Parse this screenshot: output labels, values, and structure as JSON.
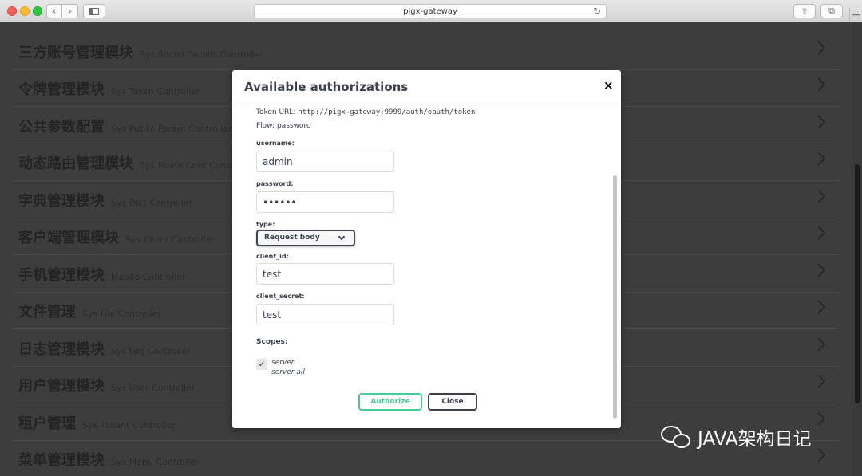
{
  "browser": {
    "url": "pigx-gateway",
    "back_icon": "chevron-left-icon",
    "forward_icon": "chevron-right-icon",
    "sidebar_icon": "sidebar-icon",
    "reload_icon": "reload-icon",
    "share_icon": "share-icon",
    "tabs_icon": "tabs-icon",
    "reload_glyph": "↻",
    "back_glyph": "‹",
    "forward_glyph": "›",
    "share_glyph": "⇧",
    "tabs_glyph": "⧉",
    "newtab_glyph": "+"
  },
  "controllers": [
    {
      "title": "三方账号管理模块",
      "subtitle": "Sys Social Details Controller"
    },
    {
      "title": "令牌管理模块",
      "subtitle": "Sys Token Controller"
    },
    {
      "title": "公共参数配置",
      "subtitle": "Sys Public Param Controller"
    },
    {
      "title": "动态路由管理模块",
      "subtitle": "Sys Route Conf Controller"
    },
    {
      "title": "字典管理模块",
      "subtitle": "Sys Dict Controller"
    },
    {
      "title": "客户端管理模块",
      "subtitle": "Sys Client Controller"
    },
    {
      "title": "手机管理模块",
      "subtitle": "Mobile Controller"
    },
    {
      "title": "文件管理",
      "subtitle": "Sys File Controller"
    },
    {
      "title": "日志管理模块",
      "subtitle": "Sys Log Controller"
    },
    {
      "title": "用户管理模块",
      "subtitle": "Sys User Controller"
    },
    {
      "title": "租户管理",
      "subtitle": "Sys Tenant Controller"
    },
    {
      "title": "菜单管理模块",
      "subtitle": "Sys Menu Controller"
    }
  ],
  "modal": {
    "title": "Available authorizations",
    "close_glyph": "×",
    "token_url_label": "Token URL:",
    "token_url": "http://pigx-gateway:9999/auth/oauth/token",
    "flow_label": "Flow:",
    "flow": "password",
    "username_label": "username:",
    "username_value": "admin",
    "password_label": "password:",
    "password_value": "••••••",
    "type_label": "type:",
    "type_value": "Request body",
    "client_id_label": "client_id:",
    "client_id_value": "test",
    "client_secret_label": "client_secret:",
    "client_secret_value": "test",
    "scopes_label": "Scopes:",
    "scope_checked": true,
    "check_glyph": "✓",
    "scope_name": "server",
    "scope_desc": "server all",
    "authorize_label": "Authorize",
    "close_label": "Close"
  },
  "watermark": {
    "text": "JAVA架构日记"
  },
  "colors": {
    "authorize": "#49cc90",
    "text": "#3b4151",
    "overlay": "#3d3d3d"
  }
}
